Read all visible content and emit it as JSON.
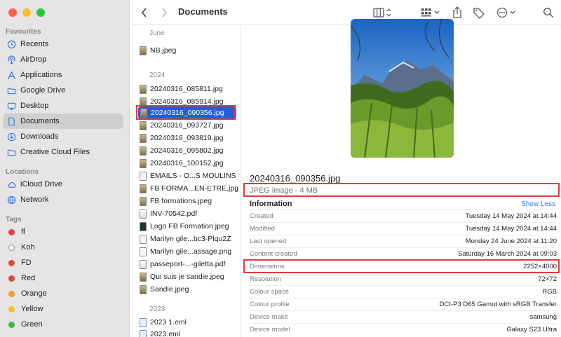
{
  "sidebar": {
    "favourites_heading": "Favourites",
    "favourites": [
      {
        "label": "Recents",
        "icon": "clock-icon"
      },
      {
        "label": "AirDrop",
        "icon": "airdrop-icon"
      },
      {
        "label": "Applications",
        "icon": "applications-icon"
      },
      {
        "label": "Google Drive",
        "icon": "folder-icon"
      },
      {
        "label": "Desktop",
        "icon": "desktop-icon"
      },
      {
        "label": "Documents",
        "icon": "document-icon"
      },
      {
        "label": "Downloads",
        "icon": "download-icon"
      },
      {
        "label": "Creative Cloud Files",
        "icon": "folder-icon"
      }
    ],
    "locations_heading": "Locations",
    "locations": [
      {
        "label": "iCloud Drive",
        "icon": "cloud-icon"
      },
      {
        "label": "Network",
        "icon": "globe-icon"
      }
    ],
    "tags_heading": "Tags",
    "tags": [
      {
        "label": "ff",
        "color": "#e8413d"
      },
      {
        "label": "Koh",
        "color": "#ffffff"
      },
      {
        "label": "FD",
        "color": "#e8413d"
      },
      {
        "label": "Red",
        "color": "#e8413d"
      },
      {
        "label": "Orange",
        "color": "#f39a2c"
      },
      {
        "label": "Yellow",
        "color": "#f2c51f"
      },
      {
        "label": "Green",
        "color": "#3db84a"
      }
    ]
  },
  "toolbar": {
    "title": "Documents"
  },
  "filelist": {
    "groups": [
      {
        "label": "June",
        "items": [
          "NB.jpeg"
        ]
      },
      {
        "label": "2024",
        "items": [
          "20240316_085811.jpg",
          "20240316_085914.jpg",
          "20240316_090356.jpg",
          "20240316_093727.jpg",
          "20240316_093819.jpg",
          "20240316_095802.jpg",
          "20240316_100152.jpg",
          "EMAILS - O...S MOULINS",
          "FB FORMA...EN-ETRE.jpg",
          "FB formations.jpeg",
          "INV-70542.pdf",
          "Logo FB Formation.jpeg",
          "Marilyn gile...bc3-Plqu2Z",
          "Marilyn gile...assage.png",
          "passeport-...-giletta.pdf",
          "Qui suis je sandie.jpeg",
          "Sandie.jpeg"
        ]
      },
      {
        "label": "2023",
        "items": [
          "2023 1.eml",
          "2023.eml"
        ]
      }
    ],
    "selected": "20240316_090356.jpg"
  },
  "preview": {
    "filename": "20240316_090356.jpg",
    "kind": "JPEG image - 4 MB",
    "info_title": "Information",
    "show_less": "Show Less",
    "rows": [
      {
        "key": "Created",
        "value": "Tuesday 14 May 2024 at 14:44"
      },
      {
        "key": "Modified",
        "value": "Tuesday 14 May 2024 at 14:44"
      },
      {
        "key": "Last opened",
        "value": "Monday 24 June 2024 at 11:20"
      },
      {
        "key": "Content created",
        "value": "Saturday 16 March 2024 at 09:03"
      },
      {
        "key": "Dimensions",
        "value": "2252×4000"
      },
      {
        "key": "Resolution",
        "value": "72×72"
      },
      {
        "key": "Colour space",
        "value": "RGB"
      },
      {
        "key": "Colour profile",
        "value": "DCI-P3 D65 Gamut with sRGB Transfer"
      },
      {
        "key": "Device make",
        "value": "samsung"
      },
      {
        "key": "Device model",
        "value": "Galaxy S23 Ultra"
      }
    ]
  }
}
